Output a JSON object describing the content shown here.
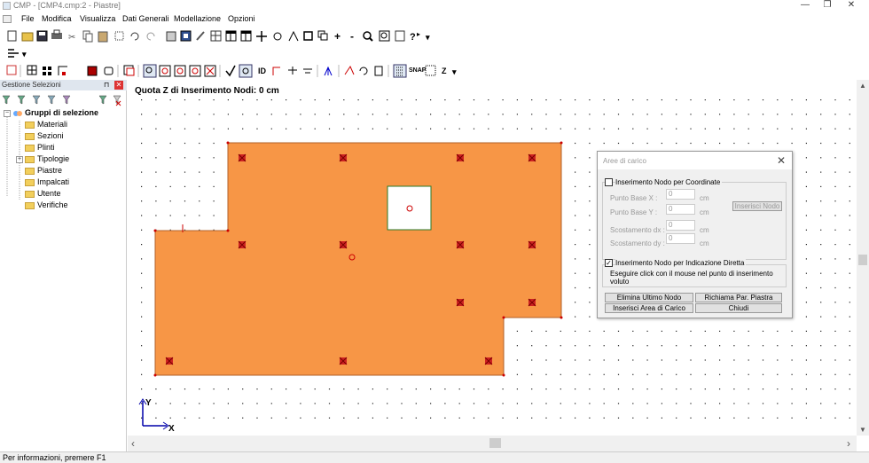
{
  "window": {
    "title": "CMP - [CMP4.cmp:2 - Piastre]",
    "minimize": "—",
    "restore": "❐",
    "close": "✕"
  },
  "menu": [
    "File",
    "Modifica",
    "Visualizza",
    "Dati Generali",
    "Modellazione",
    "Opzioni"
  ],
  "toolbar": {
    "id_label": "ID",
    "snap_label": "SNAP",
    "z_label": "Z",
    "z_dropdown": "▾",
    "help_dropdown": "▾",
    "extra_dropdown": "▾"
  },
  "left_panel": {
    "title": "Gestione Selezioni",
    "pin": "⊓",
    "close": "✕",
    "root": "Gruppi di selezione",
    "items": [
      {
        "label": "Materiali",
        "expandable": false
      },
      {
        "label": "Sezioni",
        "expandable": false
      },
      {
        "label": "Plinti",
        "expandable": false
      },
      {
        "label": "Tipologie",
        "expandable": true
      },
      {
        "label": "Piastre",
        "expandable": false
      },
      {
        "label": "Impalcati",
        "expandable": false
      },
      {
        "label": "Utente",
        "expandable": false
      },
      {
        "label": "Verifiche",
        "expandable": false
      }
    ],
    "expander_plus": "+",
    "expander_minus": "−"
  },
  "canvas": {
    "quota_label": "Quota Z di Inserimento Nodi: 0 cm",
    "axis_y": "Y",
    "axis_x": "X",
    "slab_color": "#f79646",
    "node_color": "#cc2222"
  },
  "dialog": {
    "title": "Aree di carico",
    "close": "✕",
    "coord_checkbox": "Inserimento Nodo per Coordinate",
    "coord_checked": false,
    "punto_base_x": "Punto Base X :",
    "punto_base_y": "Punto Base Y :",
    "scost_dx": "Scostamento dx :",
    "scost_dy": "Scostamento dy :",
    "value_x": "0",
    "value_y": "0",
    "value_dx": "0",
    "value_dy": "0",
    "unit": "cm",
    "inserisci_nodo": "Inserisci Nodo",
    "direct_checkbox": "Inserimento Nodo per Indicazione Diretta",
    "direct_checked": true,
    "check_mark": "✓",
    "direct_hint": "Eseguire click con il mouse nel punto di inserimento voluto",
    "btn_elimina": "Elimina Ultimo Nodo",
    "btn_richiama": "Richiama Par. Piastra",
    "btn_inserisci_area": "Inserisci Area di Carico",
    "btn_chiudi": "Chiudi"
  },
  "status": {
    "text": "Per informazioni, premere F1"
  },
  "scroll": {
    "up": "▲",
    "down": "▼",
    "left": "‹",
    "right": "›"
  }
}
